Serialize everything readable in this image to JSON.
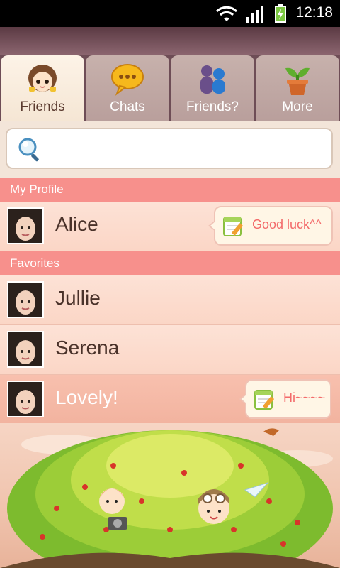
{
  "status_bar": {
    "time": "12:18"
  },
  "tabs": [
    {
      "label": "Friends",
      "icon": "girl-face-icon",
      "active": true
    },
    {
      "label": "Chats",
      "icon": "speech-bubble-icon",
      "active": false
    },
    {
      "label": "Friends?",
      "icon": "people-icon",
      "active": false
    },
    {
      "label": "More",
      "icon": "plant-pot-icon",
      "active": false
    }
  ],
  "search": {
    "placeholder": ""
  },
  "sections": {
    "my_profile": "My Profile",
    "favorites": "Favorites"
  },
  "profile": {
    "name": "Alice",
    "status": "Good luck^^"
  },
  "favorites": [
    {
      "name": "Jullie",
      "status": ""
    },
    {
      "name": "Serena",
      "status": ""
    },
    {
      "name": "Lovely!",
      "status": "Hi~~~~"
    }
  ],
  "colors": {
    "accent": "#f7908c",
    "status_text": "#f36b6b",
    "row_bg": "#fde2d6"
  }
}
